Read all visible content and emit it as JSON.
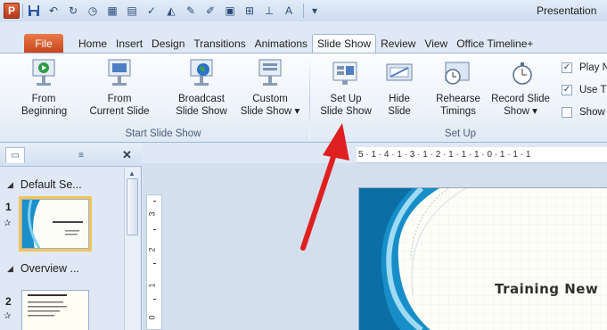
{
  "window": {
    "title": "Presentation"
  },
  "tabs": {
    "file": "File",
    "items": [
      "Home",
      "Insert",
      "Design",
      "Transitions",
      "Animations",
      "Slide Show",
      "Review",
      "View",
      "Office Timeline+"
    ],
    "active": "Slide Show"
  },
  "ribbon": {
    "start_group": {
      "label": "Start Slide Show",
      "from_beginning": [
        "From",
        "Beginning"
      ],
      "from_current": [
        "From",
        "Current Slide"
      ],
      "broadcast": [
        "Broadcast",
        "Slide Show"
      ],
      "custom": [
        "Custom",
        "Slide Show ▾"
      ]
    },
    "setup_group": {
      "label": "Set Up",
      "setup_show": [
        "Set Up",
        "Slide Show"
      ],
      "hide_slide": [
        "Hide",
        "Slide"
      ],
      "rehearse": [
        "Rehearse",
        "Timings"
      ],
      "record": [
        "Record Slide",
        "Show ▾"
      ],
      "checkboxes": [
        {
          "label": "Play N",
          "checked": true
        },
        {
          "label": "Use T",
          "checked": true
        },
        {
          "label": "Show",
          "checked": false
        }
      ]
    }
  },
  "left_panel": {
    "sections": [
      "Default Se...",
      "Overview ..."
    ],
    "slides": [
      {
        "number": "1",
        "title": "Training New Personnel",
        "selected": true
      },
      {
        "number": "2",
        "title": "New Employee Orientation",
        "selected": false
      }
    ]
  },
  "rulers": {
    "horizontal": "5 · 1 · 4 · 1 · 3 · 1 · 2 · 1 · 1 · 1 · 0 · 1 · 1 · 1",
    "vertical": [
      "3",
      "2",
      "1",
      "0"
    ]
  },
  "slide": {
    "title": "Training New"
  },
  "colors": {
    "accent_orange": "#d9541e",
    "annotation_red": "#e02020",
    "selection_gold": "#f6c458"
  }
}
